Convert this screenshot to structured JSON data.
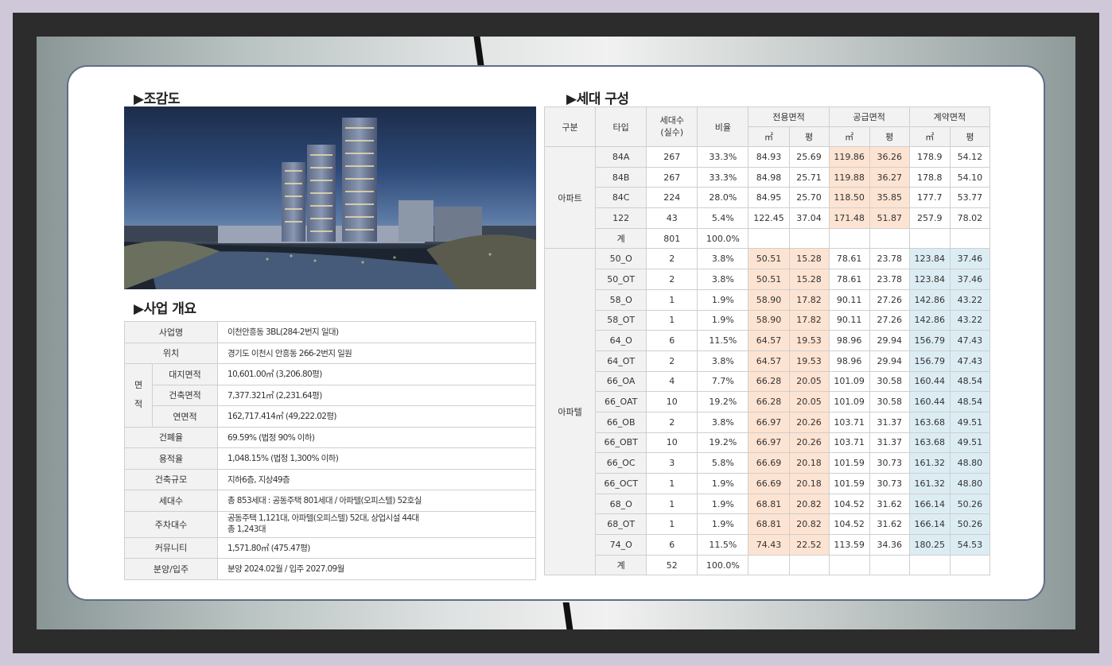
{
  "sections": {
    "aerial": "▶조감도",
    "overview": "▶사업 개요",
    "composition": "▶세대 구성"
  },
  "overview": {
    "rows": [
      {
        "label": "사업명",
        "value": "이천안흥동 3BL(284-2번지 일대)"
      },
      {
        "label": "위치",
        "value": "경기도 이천시 안흥동 266-2번지 일원"
      },
      {
        "label": "대지면적",
        "value": "10,601.00㎡ (3,206.80평)"
      },
      {
        "label": "건축면적",
        "value": "7,377.321㎡ (2,231.64평)"
      },
      {
        "label": "연면적",
        "value": "162,717.414㎡ (49,222.02평)"
      },
      {
        "label": "건폐율",
        "value": "69.59% (법정 90% 이하)"
      },
      {
        "label": "용적율",
        "value": "1,048.15% (법정 1,300% 이하)"
      },
      {
        "label": "건축규모",
        "value": "지하6층, 지상49층"
      },
      {
        "label": "세대수",
        "value": "총 853세대 : 공동주택 801세대 / 아파텔(오피스텔) 52호실"
      },
      {
        "label": "주차대수",
        "value": "공동주택 1,121대, 아파텔(오피스텔) 52대, 상업시설 44대",
        "value2": "총 1,243대"
      },
      {
        "label": "커뮤니티",
        "value": "1,571.80㎡ (475.47평)"
      },
      {
        "label": "분양/입주",
        "value": "분양 2024.02월 / 입주 2027.09월"
      }
    ],
    "area_group_chars": [
      "면",
      "적"
    ]
  },
  "units": {
    "headers": {
      "category": "구분",
      "type": "타입",
      "count": "세대수\n(실수)",
      "ratio": "비율",
      "exclusive": "전용면적",
      "supply": "공급면적",
      "contract": "계약면적",
      "sqm": "㎡",
      "pyeong": "평"
    },
    "apartment_label": "아파트",
    "apartel_label": "아파텔",
    "apartment": [
      {
        "type": "84A",
        "count": "267",
        "ratio": "33.3%",
        "ex_m": "84.93",
        "ex_p": "25.69",
        "su_m": "119.86",
        "su_p": "36.26",
        "co_m": "178.9",
        "co_p": "54.12"
      },
      {
        "type": "84B",
        "count": "267",
        "ratio": "33.3%",
        "ex_m": "84.98",
        "ex_p": "25.71",
        "su_m": "119.88",
        "su_p": "36.27",
        "co_m": "178.8",
        "co_p": "54.10"
      },
      {
        "type": "84C",
        "count": "224",
        "ratio": "28.0%",
        "ex_m": "84.95",
        "ex_p": "25.70",
        "su_m": "118.50",
        "su_p": "35.85",
        "co_m": "177.7",
        "co_p": "53.77"
      },
      {
        "type": "122",
        "count": "43",
        "ratio": "5.4%",
        "ex_m": "122.45",
        "ex_p": "37.04",
        "su_m": "171.48",
        "su_p": "51.87",
        "co_m": "257.9",
        "co_p": "78.02"
      }
    ],
    "apartment_total": {
      "type": "계",
      "count": "801",
      "ratio": "100.0%"
    },
    "apartel": [
      {
        "type": "50_O",
        "count": "2",
        "ratio": "3.8%",
        "ex_m": "50.51",
        "ex_p": "15.28",
        "su_m": "78.61",
        "su_p": "23.78",
        "co_m": "123.84",
        "co_p": "37.46"
      },
      {
        "type": "50_OT",
        "count": "2",
        "ratio": "3.8%",
        "ex_m": "50.51",
        "ex_p": "15.28",
        "su_m": "78.61",
        "su_p": "23.78",
        "co_m": "123.84",
        "co_p": "37.46"
      },
      {
        "type": "58_O",
        "count": "1",
        "ratio": "1.9%",
        "ex_m": "58.90",
        "ex_p": "17.82",
        "su_m": "90.11",
        "su_p": "27.26",
        "co_m": "142.86",
        "co_p": "43.22"
      },
      {
        "type": "58_OT",
        "count": "1",
        "ratio": "1.9%",
        "ex_m": "58.90",
        "ex_p": "17.82",
        "su_m": "90.11",
        "su_p": "27.26",
        "co_m": "142.86",
        "co_p": "43.22"
      },
      {
        "type": "64_O",
        "count": "6",
        "ratio": "11.5%",
        "ex_m": "64.57",
        "ex_p": "19.53",
        "su_m": "98.96",
        "su_p": "29.94",
        "co_m": "156.79",
        "co_p": "47.43"
      },
      {
        "type": "64_OT",
        "count": "2",
        "ratio": "3.8%",
        "ex_m": "64.57",
        "ex_p": "19.53",
        "su_m": "98.96",
        "su_p": "29.94",
        "co_m": "156.79",
        "co_p": "47.43"
      },
      {
        "type": "66_OA",
        "count": "4",
        "ratio": "7.7%",
        "ex_m": "66.28",
        "ex_p": "20.05",
        "su_m": "101.09",
        "su_p": "30.58",
        "co_m": "160.44",
        "co_p": "48.54"
      },
      {
        "type": "66_OAT",
        "count": "10",
        "ratio": "19.2%",
        "ex_m": "66.28",
        "ex_p": "20.05",
        "su_m": "101.09",
        "su_p": "30.58",
        "co_m": "160.44",
        "co_p": "48.54"
      },
      {
        "type": "66_OB",
        "count": "2",
        "ratio": "3.8%",
        "ex_m": "66.97",
        "ex_p": "20.26",
        "su_m": "103.71",
        "su_p": "31.37",
        "co_m": "163.68",
        "co_p": "49.51"
      },
      {
        "type": "66_OBT",
        "count": "10",
        "ratio": "19.2%",
        "ex_m": "66.97",
        "ex_p": "20.26",
        "su_m": "103.71",
        "su_p": "31.37",
        "co_m": "163.68",
        "co_p": "49.51"
      },
      {
        "type": "66_OC",
        "count": "3",
        "ratio": "5.8%",
        "ex_m": "66.69",
        "ex_p": "20.18",
        "su_m": "101.59",
        "su_p": "30.73",
        "co_m": "161.32",
        "co_p": "48.80"
      },
      {
        "type": "66_OCT",
        "count": "1",
        "ratio": "1.9%",
        "ex_m": "66.69",
        "ex_p": "20.18",
        "su_m": "101.59",
        "su_p": "30.73",
        "co_m": "161.32",
        "co_p": "48.80"
      },
      {
        "type": "68_O",
        "count": "1",
        "ratio": "1.9%",
        "ex_m": "68.81",
        "ex_p": "20.82",
        "su_m": "104.52",
        "su_p": "31.62",
        "co_m": "166.14",
        "co_p": "50.26"
      },
      {
        "type": "68_OT",
        "count": "1",
        "ratio": "1.9%",
        "ex_m": "68.81",
        "ex_p": "20.82",
        "su_m": "104.52",
        "su_p": "31.62",
        "co_m": "166.14",
        "co_p": "50.26"
      },
      {
        "type": "74_O",
        "count": "6",
        "ratio": "11.5%",
        "ex_m": "74.43",
        "ex_p": "22.52",
        "su_m": "113.59",
        "su_p": "34.36",
        "co_m": "180.25",
        "co_p": "54.53"
      }
    ],
    "apartel_total": {
      "type": "계",
      "count": "52",
      "ratio": "100.0%"
    }
  },
  "colors": {
    "supply_highlight": "#fde3d2",
    "exclusive_highlight": "#fde3d2",
    "contract_highlight": "#dcecf3",
    "header_bg": "#f2f2f2",
    "card_border": "#5f6e86"
  }
}
